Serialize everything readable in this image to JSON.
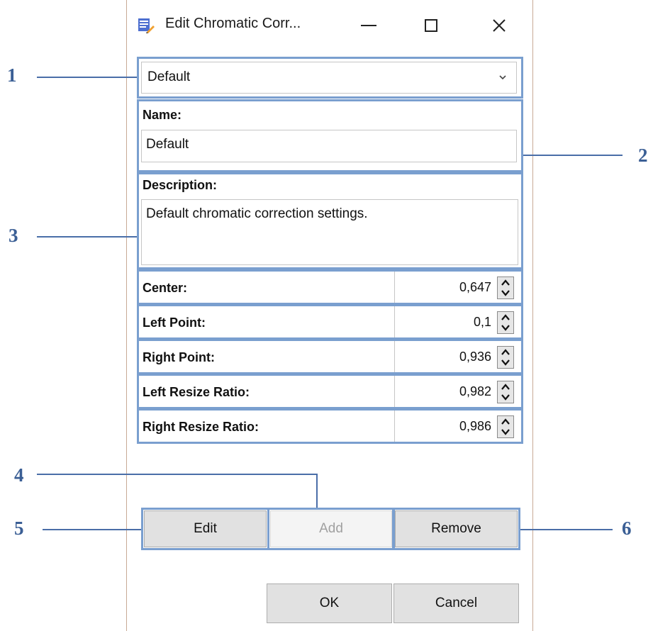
{
  "window": {
    "title": "Edit Chromatic Corr..."
  },
  "preset_dropdown": {
    "selected": "Default"
  },
  "name": {
    "label": "Name:",
    "value": "Default"
  },
  "description": {
    "label": "Description:",
    "value": "Default chromatic correction settings."
  },
  "params": [
    {
      "label": "Center:",
      "value": "0,647"
    },
    {
      "label": "Left Point:",
      "value": "0,1"
    },
    {
      "label": "Right Point:",
      "value": "0,936"
    },
    {
      "label": "Left Resize Ratio:",
      "value": "0,982"
    },
    {
      "label": "Right Resize Ratio:",
      "value": "0,986"
    }
  ],
  "buttons": {
    "edit": "Edit",
    "add": "Add",
    "remove": "Remove",
    "ok": "OK",
    "cancel": "Cancel"
  },
  "callouts": [
    "1",
    "2",
    "3",
    "4",
    "5",
    "6"
  ],
  "colors": {
    "callout_box": "#7a9fcf",
    "callout_text": "#3b5f95",
    "button_face": "#e1e1e1"
  }
}
